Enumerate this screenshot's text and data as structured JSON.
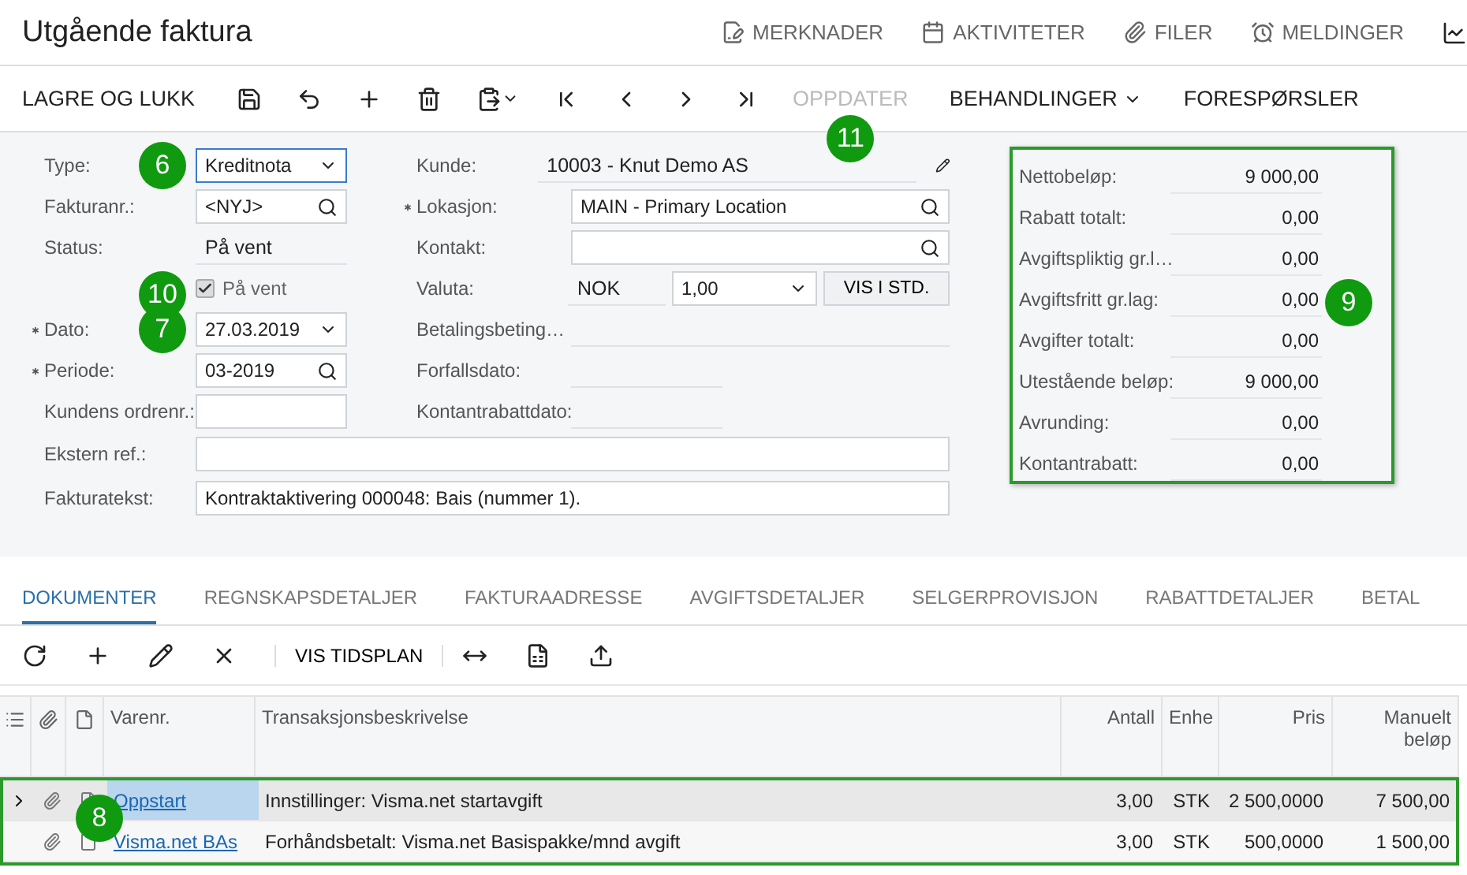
{
  "header": {
    "title": "Utgående faktura",
    "links": [
      {
        "label": "MERKNADER"
      },
      {
        "label": "AKTIVITETER"
      },
      {
        "label": "FILER"
      },
      {
        "label": "MELDINGER"
      }
    ]
  },
  "toolbar": [
    {
      "kind": "text",
      "label": "LAGRE OG LUKK"
    },
    {
      "kind": "icon"
    },
    {
      "kind": "icon"
    },
    {
      "kind": "icon"
    },
    {
      "kind": "icon"
    },
    {
      "kind": "icon-menu"
    },
    {
      "kind": "icon"
    },
    {
      "kind": "icon"
    },
    {
      "kind": "icon"
    },
    {
      "kind": "icon"
    },
    {
      "kind": "text",
      "label": "OPPDATER",
      "disabled": true,
      "callout": "11"
    },
    {
      "kind": "menu",
      "label": "BEHANDLINGER"
    },
    {
      "kind": "text",
      "label": "FORESPØRSLER"
    }
  ],
  "form": {
    "left": [
      {
        "label": "Type:",
        "kind": "select",
        "value": "Kreditnota",
        "focused": true,
        "callout": "6"
      },
      {
        "label": "Fakturanr.:",
        "kind": "lookup",
        "value": "<NYJ>"
      },
      {
        "label": "Status:",
        "kind": "readonly",
        "value": "På vent"
      },
      {
        "kind": "checkbox",
        "value": "På vent",
        "checked": true,
        "callout": "10"
      },
      {
        "label": "Dato:",
        "kind": "select",
        "value": "27.03.2019",
        "required": true,
        "callout": "7"
      },
      {
        "label": "Periode:",
        "kind": "lookup",
        "value": "03-2019",
        "required": true
      },
      {
        "label": "Kundens ordrenr.:",
        "kind": "input"
      }
    ],
    "middle": [
      {
        "label": "Kunde:",
        "kind": "readonly",
        "value": "10003 - Knut Demo AS"
      },
      {
        "label": "Lokasjon:",
        "kind": "lookup",
        "value": "MAIN - Primary Location",
        "required": true
      },
      {
        "label": "Kontakt:",
        "kind": "lookup"
      },
      {
        "label": "Valuta:",
        "kind": "currency",
        "value": "NOK",
        "rate": "1,00",
        "button": "VIS I STD."
      },
      {
        "label": "Betalingsbeting…",
        "kind": "readonly"
      },
      {
        "label": "Forfallsdato:",
        "kind": "readonly-short"
      },
      {
        "label": "Kontantrabattdato:",
        "kind": "readonly-short"
      }
    ],
    "wide": [
      {
        "label": "Ekstern ref.:"
      },
      {
        "label": "Fakturatekst:",
        "value": "Kontraktaktivering 000048: Bais (nummer 1)."
      }
    ]
  },
  "summary": {
    "highlighted": true,
    "callout": "9",
    "rows": [
      {
        "label": "Nettobeløp:",
        "value": "9 000,00"
      },
      {
        "label": "Rabatt totalt:",
        "value": "0,00"
      },
      {
        "label": "Avgiftspliktig gr.l…",
        "value": "0,00"
      },
      {
        "label": "Avgiftsfritt gr.lag:",
        "value": "0,00"
      },
      {
        "label": "Avgifter totalt:",
        "value": "0,00"
      },
      {
        "label": "Utestående beløp:",
        "value": "9 000,00"
      },
      {
        "label": "Avrunding:",
        "value": "0,00"
      },
      {
        "label": "Kontantrabatt:",
        "value": "0,00"
      }
    ]
  },
  "tabs": [
    {
      "label": "DOKUMENTER",
      "selected": true
    },
    {
      "label": "REGNSKAPSDETALJER",
      "selected": false
    },
    {
      "label": "FAKTURAADRESSE",
      "selected": false
    },
    {
      "label": "AVGIFTSDETALJER",
      "selected": false
    },
    {
      "label": "SELGERPROVISJON",
      "selected": false
    },
    {
      "label": "RABATTDETALJER",
      "selected": false
    },
    {
      "label": "BETAL",
      "selected": false
    }
  ],
  "grid_toolbar": [
    {
      "kind": "icon"
    },
    {
      "kind": "icon"
    },
    {
      "kind": "icon"
    },
    {
      "kind": "icon"
    },
    {
      "kind": "text",
      "label": "VIS TIDSPLAN"
    },
    {
      "kind": "icon"
    },
    {
      "kind": "icon"
    },
    {
      "kind": "icon"
    }
  ],
  "grid": {
    "highlighted": true,
    "callout": "8",
    "columns": [
      "Varenr.",
      "Transaksjonsbeskrivelse",
      "Antall",
      "Enhe",
      "Pris",
      "Manuelt beløp"
    ],
    "rows": [
      {
        "selected": true,
        "item": "Oppstart",
        "description": "Innstillinger: Visma.net startavgift",
        "qty": "3,00",
        "unit": "STK",
        "price": "2 500,0000",
        "amount": "7 500,00"
      },
      {
        "selected": false,
        "item": "Visma.net BAs",
        "description": "Forhåndsbetalt: Visma.net Basispakke/mnd avgift",
        "qty": "3,00",
        "unit": "STK",
        "price": "500,0000",
        "amount": "1 500,00"
      }
    ]
  }
}
